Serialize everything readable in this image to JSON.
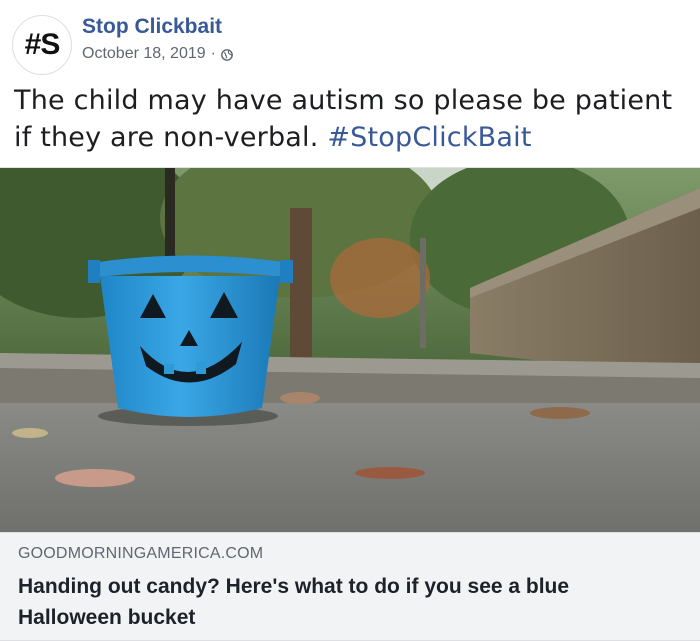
{
  "post": {
    "avatar_text": "#S",
    "page_name": "Stop Clickbait",
    "date": "October 18, 2019",
    "separator": "·",
    "privacy_icon": "globe-icon",
    "text": "The child may have autism so please be patient if they are non-verbal.",
    "hashtag": "#StopClickBait"
  },
  "link_preview": {
    "domain": "GOODMORNINGAMERICA.COM",
    "title": "Handing out candy? Here's what to do if you see a blue Halloween bucket"
  },
  "colors": {
    "link_blue": "#385898",
    "bucket_blue": "#2e9bd6",
    "preview_bg": "#f2f3f5"
  }
}
